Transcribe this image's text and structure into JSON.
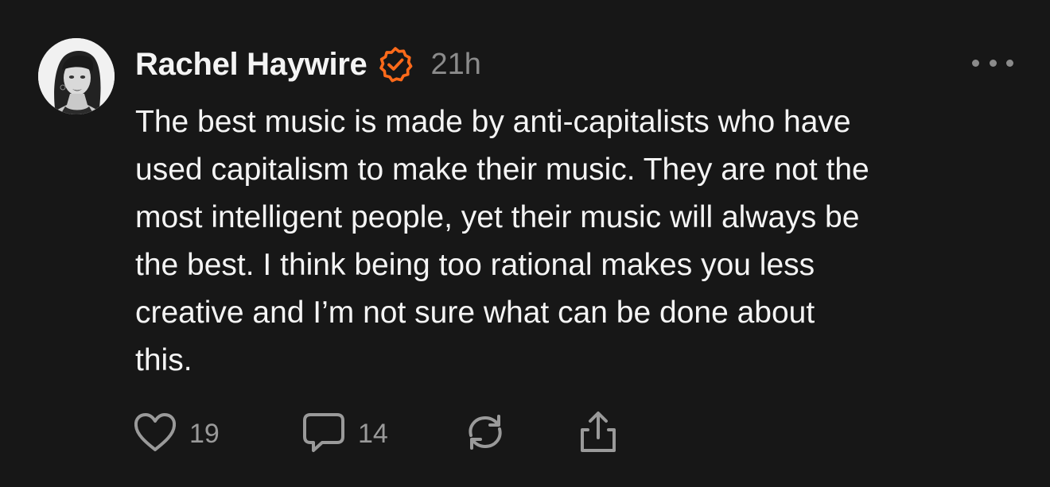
{
  "post": {
    "author": {
      "name": "Rachel Haywire",
      "verified": true,
      "avatar_icon": "profile-photo"
    },
    "timestamp": "21h",
    "text_lines": [
      "The best music is made by anti-capitalists who have",
      "used capitalism to make their music. They are not the",
      "most intelligent people, yet their music will always be",
      "the best. I think being too rational makes you less",
      "creative and I’m not sure what can be done about",
      "this."
    ],
    "actions": {
      "like": {
        "icon": "heart-icon",
        "count": "19"
      },
      "reply": {
        "icon": "comment-icon",
        "count": "14"
      },
      "repost": {
        "icon": "repost-icon"
      },
      "share": {
        "icon": "share-icon"
      }
    },
    "more_icon": "more-horizontal-icon"
  },
  "colors": {
    "background": "#171717",
    "text": "#f4f4f4",
    "muted": "#8b8b8b",
    "verified": "#ff6a1a"
  }
}
